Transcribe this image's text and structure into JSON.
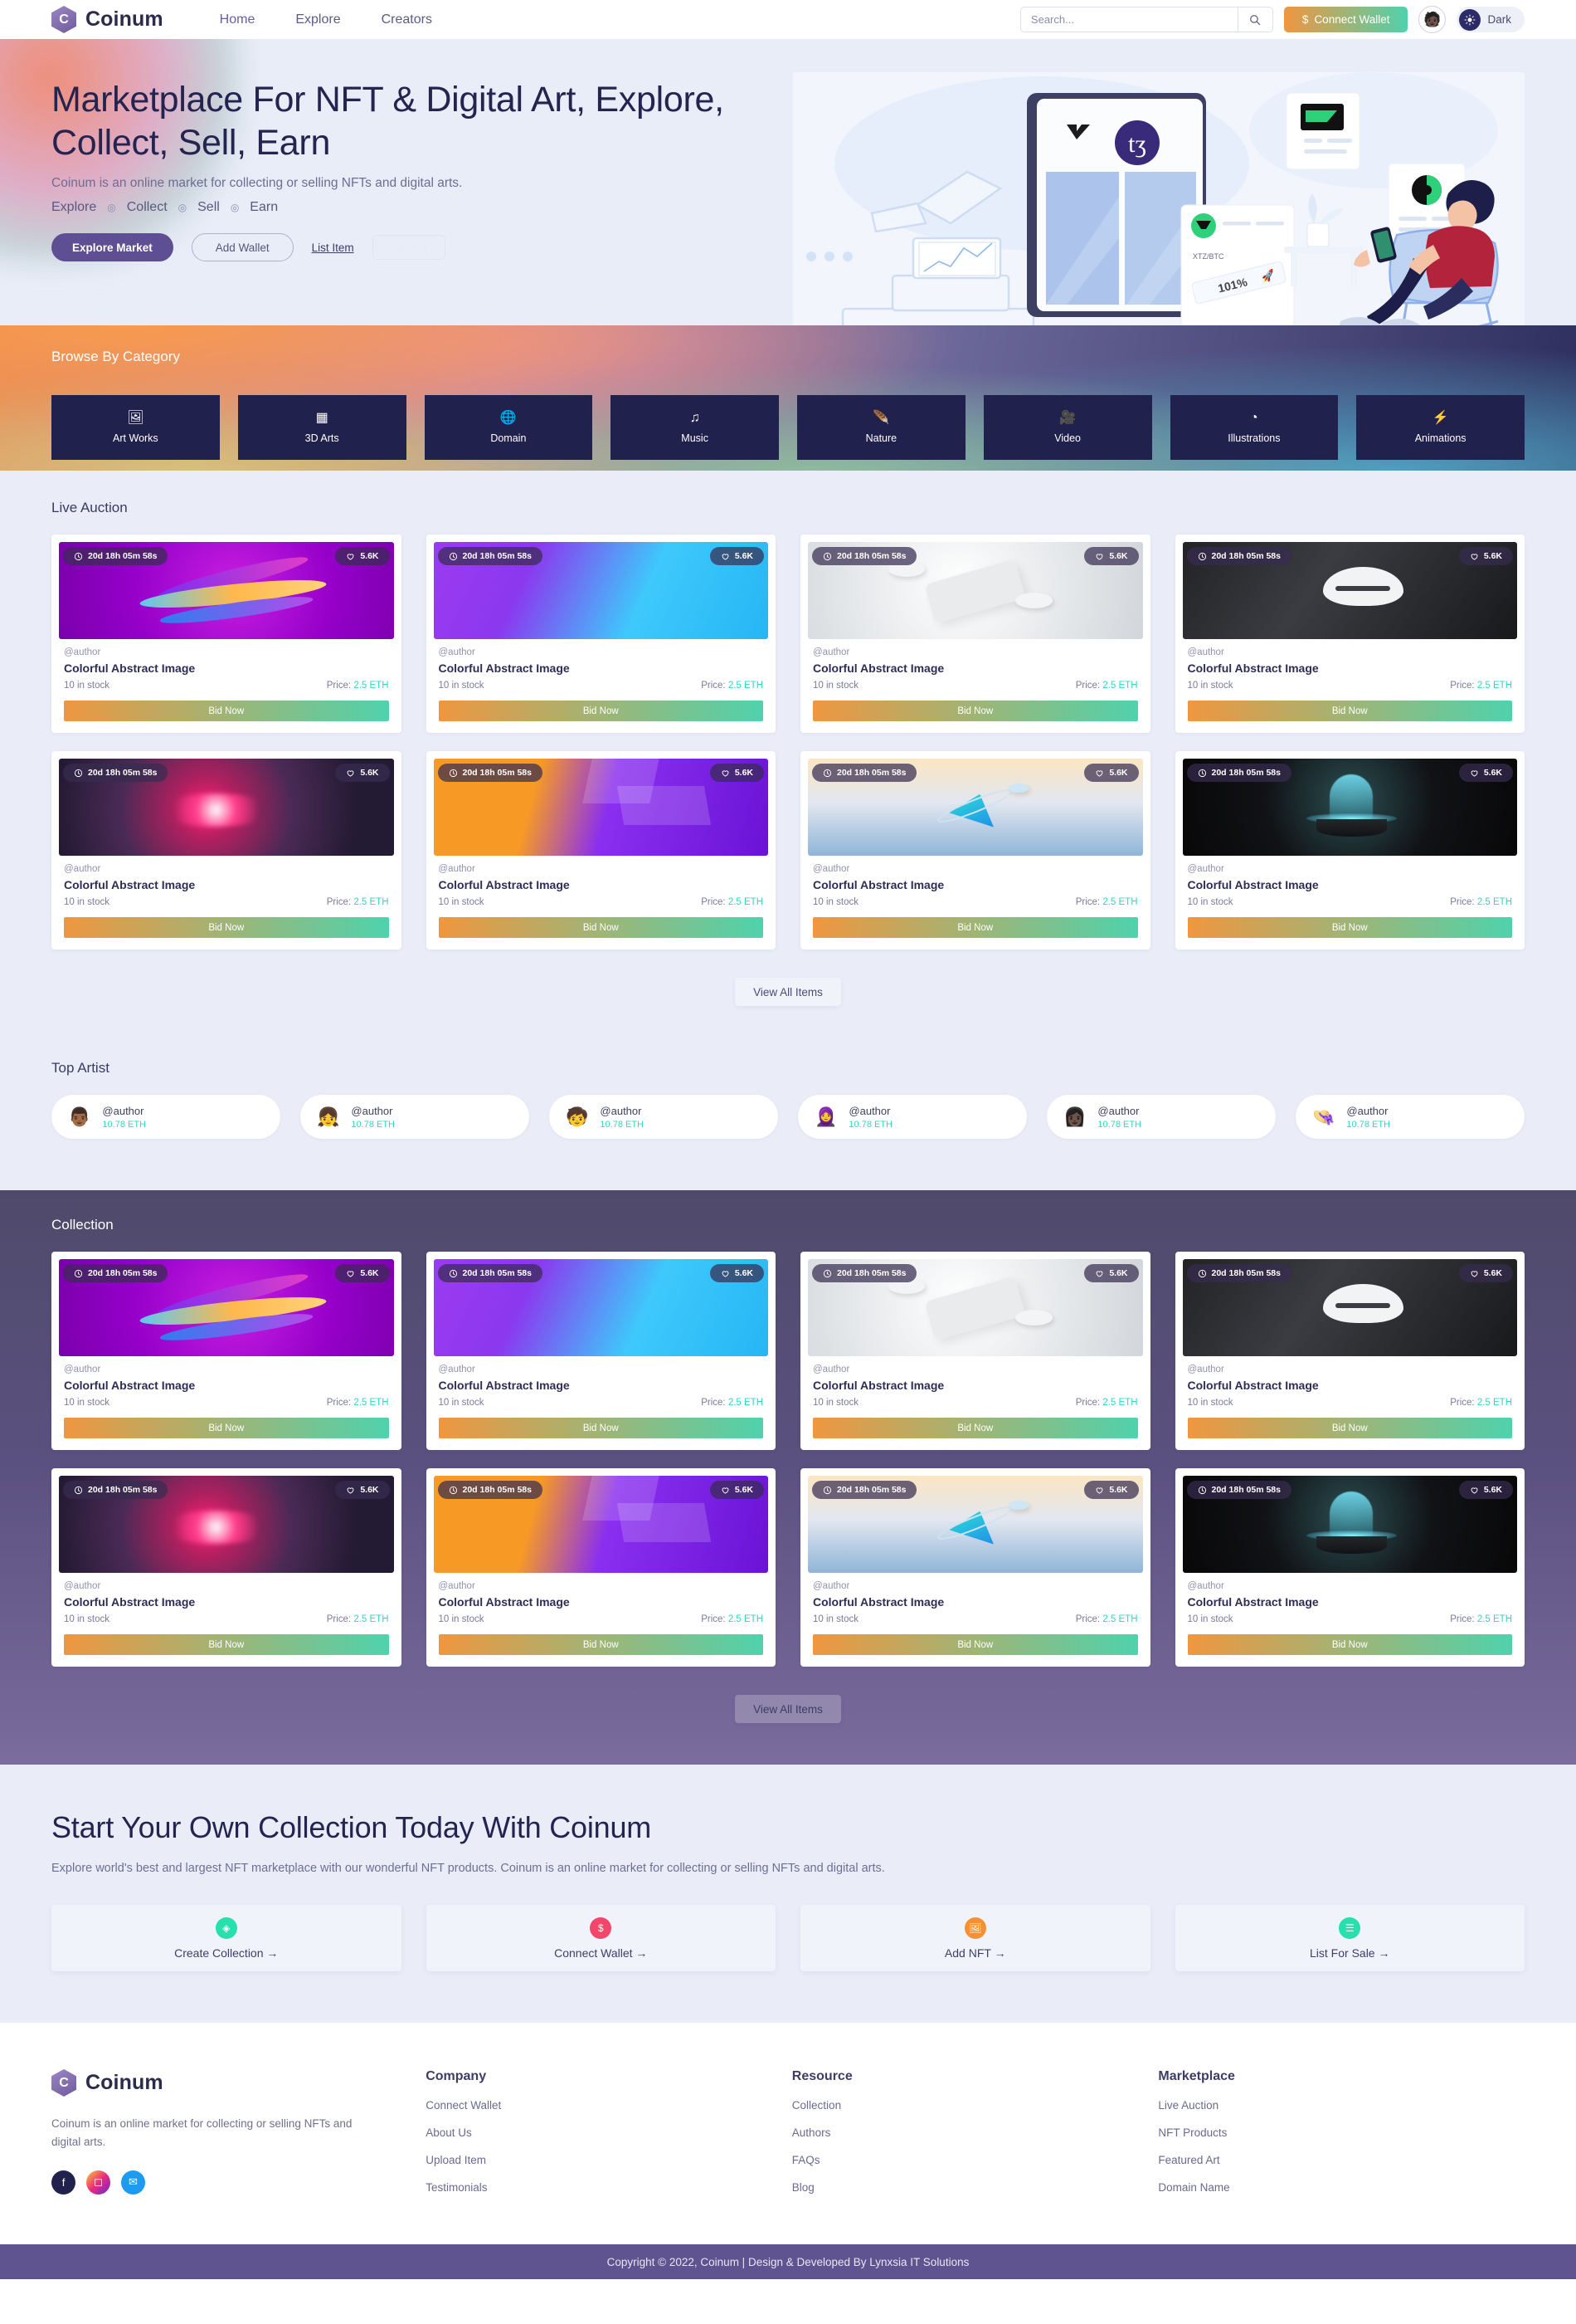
{
  "header": {
    "brand": "Coinum",
    "brand_initial": "C",
    "nav": [
      {
        "label": "Home",
        "active": true
      },
      {
        "label": "Explore",
        "active": false
      },
      {
        "label": "Creators",
        "active": false
      }
    ],
    "search": {
      "placeholder": "Search...",
      "value": "",
      "icon": "search-icon"
    },
    "connect_wallet": {
      "label": "Connect Wallet",
      "icon": "dollar-icon"
    },
    "avatar": "🧑🏿",
    "dark_toggle": {
      "label": "Dark",
      "icon": "sun-icon"
    }
  },
  "hero": {
    "title": "Marketplace For NFT & Digital Art, Explore, Collect, Sell, Earn",
    "subtitle": "Coinum is an online market for collecting or selling NFTs and digital arts.",
    "steps": [
      "Explore",
      "Collect",
      "Sell",
      "Earn"
    ],
    "buttons": {
      "primary": "Explore Market",
      "outline": "Add Wallet",
      "link": "List Item",
      "inverse": "Inverse"
    }
  },
  "category": {
    "title": "Browse By Category",
    "items": [
      {
        "label": "Art Works",
        "icon": "🖼"
      },
      {
        "label": "3D Arts",
        "icon": "▦"
      },
      {
        "label": "Domain",
        "icon": "🌐"
      },
      {
        "label": "Music",
        "icon": "♫"
      },
      {
        "label": "Nature",
        "icon": "🪶"
      },
      {
        "label": "Video",
        "icon": "🎥"
      },
      {
        "label": "Illustrations",
        "icon": "◔"
      },
      {
        "label": "Animations",
        "icon": "⚡"
      }
    ]
  },
  "live_auction": {
    "title": "Live Auction",
    "view_all": "View All Items",
    "card_defaults": {
      "countdown": "20d 18h 05m 58s",
      "likes": "5.6K",
      "author": "@author",
      "name": "Colorful Abstract Image",
      "stock": "10 in stock",
      "price_label": "Price:",
      "price_value": "2.5 ETH",
      "bid_label": "Bid Now",
      "clock_icon": "clock-icon",
      "heart_icon": "heart-icon"
    },
    "cards": [
      {
        "art": "art1"
      },
      {
        "art": "art2"
      },
      {
        "art": "art3"
      },
      {
        "art": "art4"
      },
      {
        "art": "art5"
      },
      {
        "art": "art6"
      },
      {
        "art": "art7"
      },
      {
        "art": "art8"
      }
    ]
  },
  "top_artist": {
    "title": "Top Artist",
    "artists": [
      {
        "avatar": "👨🏾",
        "name": "@author",
        "eth": "10.78 ETH"
      },
      {
        "avatar": "👧",
        "name": "@author",
        "eth": "10.78 ETH"
      },
      {
        "avatar": "🧒",
        "name": "@author",
        "eth": "10.78 ETH"
      },
      {
        "avatar": "🧕",
        "name": "@author",
        "eth": "10.78 ETH"
      },
      {
        "avatar": "👩🏿",
        "name": "@author",
        "eth": "10.78 ETH"
      },
      {
        "avatar": "👒",
        "name": "@author",
        "eth": "10.78 ETH"
      }
    ]
  },
  "collection": {
    "title": "Collection",
    "view_all": "View All Items",
    "cards": [
      {
        "art": "art1"
      },
      {
        "art": "art2"
      },
      {
        "art": "art3"
      },
      {
        "art": "art4"
      },
      {
        "art": "art5"
      },
      {
        "art": "art6"
      },
      {
        "art": "art7"
      },
      {
        "art": "art8"
      }
    ]
  },
  "cta": {
    "title": "Start Your Own Collection Today With Coinum",
    "subtitle": "Explore world's best and largest NFT marketplace with our wonderful NFT products. Coinum is an online market for collecting or selling NFTs and digital arts.",
    "cards": [
      {
        "label": "Create Collection →",
        "icon": "◈",
        "color": "#27e0ad",
        "icon_name": "diamond-icon"
      },
      {
        "label": "Connect Wallet →",
        "icon": "$",
        "color": "#f2476a",
        "icon_name": "dollar-icon"
      },
      {
        "label": "Add NFT →",
        "icon": "🖼",
        "color": "#f59133",
        "icon_name": "image-icon"
      },
      {
        "label": "List For Sale →",
        "icon": "☰",
        "color": "#27e0ad",
        "icon_name": "list-icon"
      }
    ]
  },
  "footer": {
    "brand": "Coinum",
    "brand_initial": "C",
    "description": "Coinum is an online market for collecting or selling NFTs and digital arts.",
    "social": [
      {
        "icon": "f",
        "name": "facebook-icon",
        "color": "#21214e"
      },
      {
        "icon": "◻",
        "name": "instagram-icon",
        "color": "#c76a9a"
      },
      {
        "icon": "✉",
        "name": "twitter-icon",
        "color": "#1d9bf0"
      }
    ],
    "columns": [
      {
        "heading": "Company",
        "links": [
          "Connect Wallet",
          "About Us",
          "Upload Item",
          "Testimonials"
        ]
      },
      {
        "heading": "Resource",
        "links": [
          "Collection",
          "Authors",
          "FAQs",
          "Blog"
        ]
      },
      {
        "heading": "Marketplace",
        "links": [
          "Live Auction",
          "NFT Products",
          "Featured Art",
          "Domain Name"
        ]
      }
    ],
    "copyright": "Copyright © 2022, Coinum | Design & Developed By Lynxsia IT Solutions"
  },
  "colors": {
    "accent_purple": "#5e4f94",
    "accent_teal": "#2fd6c4",
    "gradient_start": "#ef9740",
    "gradient_end": "#4fd2ac",
    "dark_navy": "#21214e",
    "page_bg": "#eaedf8"
  }
}
